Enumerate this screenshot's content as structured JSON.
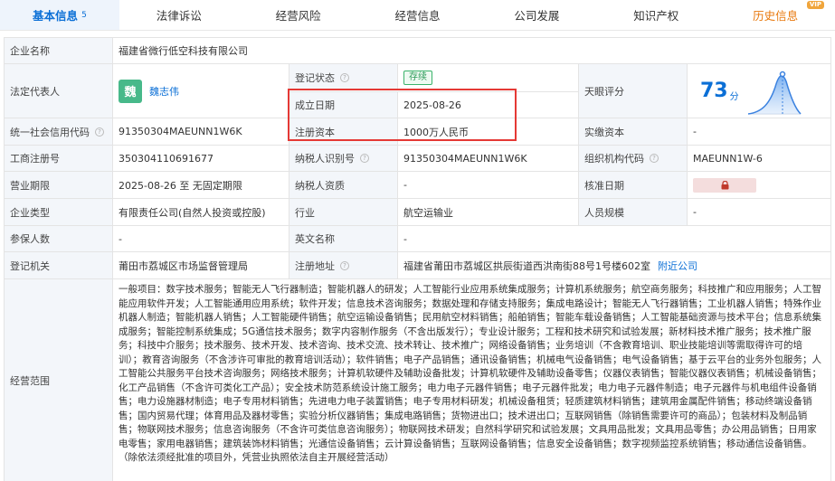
{
  "tabs": [
    {
      "label": "基本信息",
      "count": "5",
      "active": true
    },
    {
      "label": "法律诉讼"
    },
    {
      "label": "经营风险"
    },
    {
      "label": "经营信息"
    },
    {
      "label": "公司发展"
    },
    {
      "label": "知识产权"
    },
    {
      "label": "历史信息",
      "badge": "VIP"
    }
  ],
  "info": {
    "company_name_label": "企业名称",
    "company_name": "福建省微行低空科技有限公司",
    "legal_rep_label": "法定代表人",
    "legal_rep_avatar": "魏",
    "legal_rep_name": "魏志伟",
    "reg_status_label": "登记状态",
    "reg_status": "存续",
    "est_date_label": "成立日期",
    "est_date": "2025-08-26",
    "reg_capital_label": "注册资本",
    "reg_capital": "1000万人民币",
    "tianyan_label": "天眼评分",
    "tianyan_score": "73",
    "tianyan_unit": "分",
    "paid_capital_label": "实缴资本",
    "paid_capital": "-",
    "credit_code_label": "统一社会信用代码",
    "credit_code": "91350304MAEUNN1W6K",
    "biz_reg_no_label": "工商注册号",
    "biz_reg_no": "350304110691677",
    "taxpayer_id_label": "纳税人识别号",
    "taxpayer_id": "91350304MAEUNN1W6K",
    "org_code_label": "组织机构代码",
    "org_code": "MAEUNN1W-6",
    "term_label": "营业期限",
    "term": "2025-08-26 至 无固定期限",
    "taxpayer_qual_label": "纳税人资质",
    "taxpayer_qual": "-",
    "approval_date_label": "核准日期",
    "company_type_label": "企业类型",
    "company_type": "有限责任公司(自然人投资或控股)",
    "industry_label": "行业",
    "industry": "航空运输业",
    "staff_size_label": "人员规模",
    "staff_size": "-",
    "insured_label": "参保人数",
    "insured": "-",
    "english_name_label": "英文名称",
    "english_name": "-",
    "reg_authority_label": "登记机关",
    "reg_authority": "莆田市荔城区市场监督管理局",
    "reg_address_label": "注册地址",
    "reg_address": "福建省莆田市荔城区拱辰街道西洪南街88号1号楼602室",
    "nearby_link": "附近公司",
    "scope_label": "经营范围",
    "scope": "一般项目：数字技术服务；智能无人飞行器制造；智能机器人的研发；人工智能行业应用系统集成服务；计算机系统服务；航空商务服务；科技推广和应用服务；人工智能应用软件开发；人工智能通用应用系统；软件开发；信息技术咨询服务；数据处理和存储支持服务；集成电路设计；智能无人飞行器销售；工业机器人销售；特殊作业机器人制造；智能机器人销售；人工智能硬件销售；航空运输设备销售；民用航空材料销售；船舶销售；智能车载设备销售；人工智能基础资源与技术平台；信息系统集成服务；智能控制系统集成；5G通信技术服务；数字内容制作服务（不含出版发行）；专业设计服务；工程和技术研究和试验发展；新材料技术推广服务；技术推广服务；科技中介服务；技术服务、技术开发、技术咨询、技术交流、技术转让、技术推广；网络设备销售；业务培训（不含教育培训、职业技能培训等需取得许可的培训）；教育咨询服务（不含涉许可审批的教育培训活动）；软件销售；电子产品销售；通讯设备销售；机械电气设备销售；电气设备销售；基于云平台的业务外包服务；人工智能公共服务平台技术咨询服务；网络技术服务；计算机软硬件及辅助设备批发；计算机软硬件及辅助设备零售；仪器仪表销售；智能仪器仪表销售；机械设备销售；化工产品销售（不含许可类化工产品）；安全技术防范系统设计施工服务；电力电子元器件销售；电子元器件批发；电力电子元器件制造；电子元器件与机电组件设备销售；电力设施器材制造；电子专用材料销售；先进电力电子装置销售；电子专用材料研发；机械设备租赁；轻质建筑材料销售；建筑用金属配件销售；移动终端设备销售；国内贸易代理；体育用品及器材零售；实验分析仪器销售；集成电路销售；货物进出口；技术进出口；互联网销售（除销售需要许可的商品）；包装材料及制品销售；物联网技术服务；信息咨询服务（不含许可类信息咨询服务）；物联网技术研发；自然科学研究和试验发展；文具用品批发；文具用品零售；办公用品销售；日用家电零售；家用电器销售；建筑装饰材料销售；光通信设备销售；云计算设备销售；互联网设备销售；信息安全设备销售；数字视频监控系统销售；移动通信设备销售。（除依法须经批准的项目外，凭营业执照依法自主开展经营活动）"
  },
  "colors": {
    "accent": "#0b6fd6",
    "status_green": "#2c9a58",
    "highlight_red": "#e53935",
    "history_orange": "#e8780c"
  }
}
